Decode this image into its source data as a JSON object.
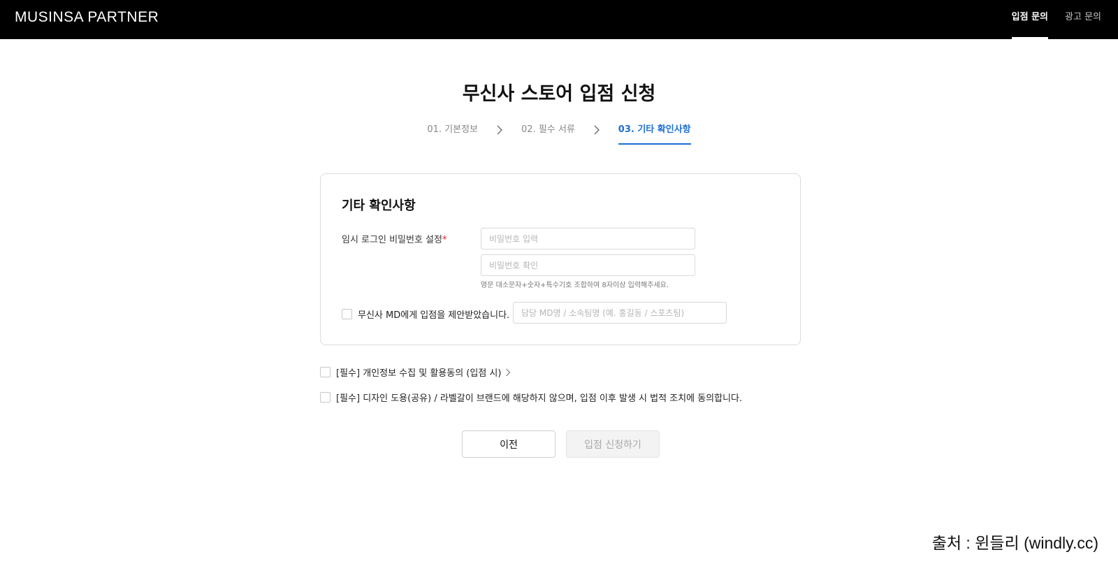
{
  "header": {
    "logo": "MUSINSA PARTNER",
    "nav": [
      {
        "label": "입점 문의",
        "active": true
      },
      {
        "label": "광고 문의",
        "active": false
      }
    ]
  },
  "page_title": "무신사 스토어 입점 신청",
  "steps": [
    {
      "label": "01. 기본정보",
      "active": false
    },
    {
      "label": "02. 필수 서류",
      "active": false
    },
    {
      "label": "03. 기타 확인사항",
      "active": true
    }
  ],
  "card": {
    "title": "기타 확인사항",
    "password_label": "임시 로그인 비밀번호 설정",
    "required_mark": "*",
    "password_placeholder": "비밀번호 입력",
    "password_confirm_placeholder": "비밀번호 확인",
    "password_hint": "영문 대소문자+숫자+특수기호 조합하여 8자이상 입력해주세요.",
    "md_checkbox_label": "무신사 MD에게 입점을 제안받았습니다.",
    "md_placeholder": "담당 MD명 / 소속팀명 (예. 홍길동 / 스포츠팀)"
  },
  "agreements": {
    "privacy": "[필수] 개인정보 수집 및 활용동의 (입점 시)",
    "design": "[필수] 디자인 도용(공유) / 라벨갈이 브랜드에 해당하지 않으며, 입점 이후 발생 시 법적 조치에 동의합니다."
  },
  "buttons": {
    "prev": "이전",
    "submit": "입점 신청하기"
  },
  "source_caption": "출처 : 윈들리 (windly.cc)",
  "colors": {
    "accent": "#1d6fd6",
    "header_bg": "#000000",
    "required": "#e0202a"
  }
}
